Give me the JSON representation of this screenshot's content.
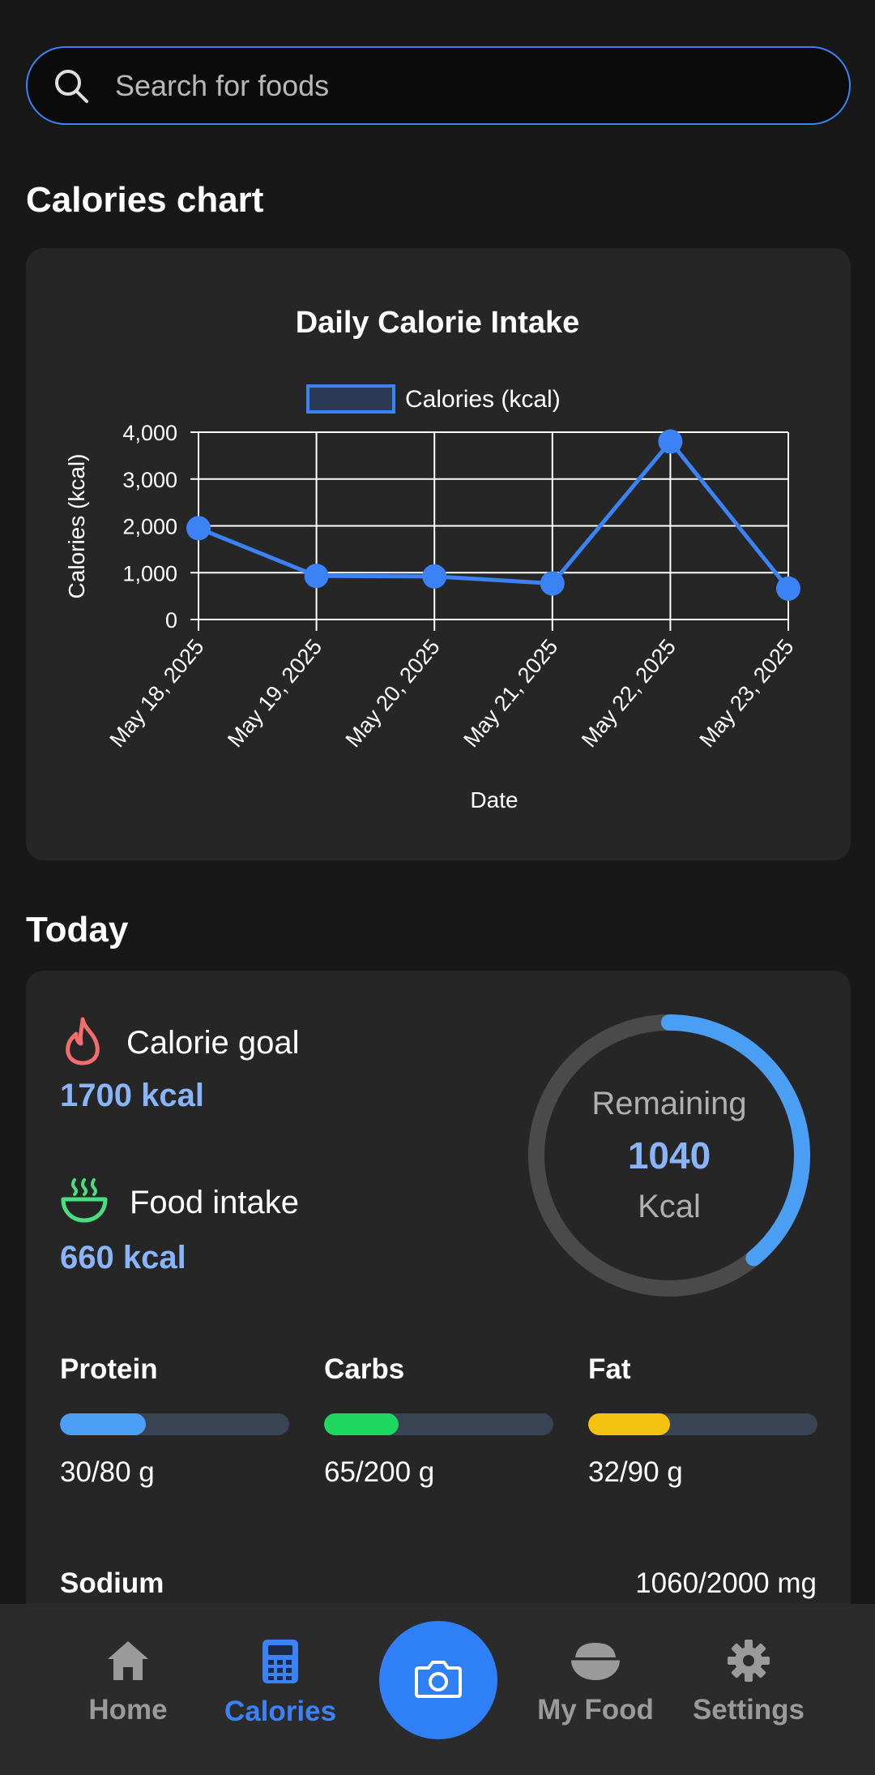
{
  "search": {
    "placeholder": "Search for foods"
  },
  "chart_section_title": "Calories chart",
  "chart_data": {
    "type": "line",
    "title": "Daily Calorie Intake",
    "xlabel": "Date",
    "ylabel": "Calories (kcal)",
    "categories": [
      "May 18, 2025",
      "May 19, 2025",
      "May 20, 2025",
      "May 21, 2025",
      "May 22, 2025",
      "May 23, 2025"
    ],
    "series": [
      {
        "name": "Calories (kcal)",
        "values": [
          1950,
          930,
          920,
          770,
          3800,
          660
        ]
      }
    ],
    "ylim": [
      0,
      4000
    ],
    "yticks": [
      "0",
      "1,000",
      "2,000",
      "3,000",
      "4,000"
    ],
    "ytick_values": [
      0,
      1000,
      2000,
      3000,
      4000
    ],
    "grid": true,
    "legend_position": "top",
    "color": "#3b82f6"
  },
  "today_title": "Today",
  "calorie_goal": {
    "label": "Calorie goal",
    "value": "1700 kcal",
    "icon": "flame-icon"
  },
  "food_intake": {
    "label": "Food intake",
    "value": "660 kcal",
    "icon": "bowl-icon"
  },
  "remaining": {
    "label": "Remaining",
    "value": "1040",
    "unit": "Kcal",
    "progress": 0.39
  },
  "macros": [
    {
      "name": "Protein",
      "amount": "30/80 g",
      "fraction": 0.375,
      "color": "#4a9ff5"
    },
    {
      "name": "Carbs",
      "amount": "65/200 g",
      "fraction": 0.325,
      "color": "#1ed760"
    },
    {
      "name": "Fat",
      "amount": "32/90 g",
      "fraction": 0.356,
      "color": "#f5c211"
    }
  ],
  "sodium": {
    "label": "Sodium",
    "value": "1060/2000 mg"
  },
  "nav": {
    "home": "Home",
    "calories": "Calories",
    "my_food": "My Food",
    "settings": "Settings"
  }
}
